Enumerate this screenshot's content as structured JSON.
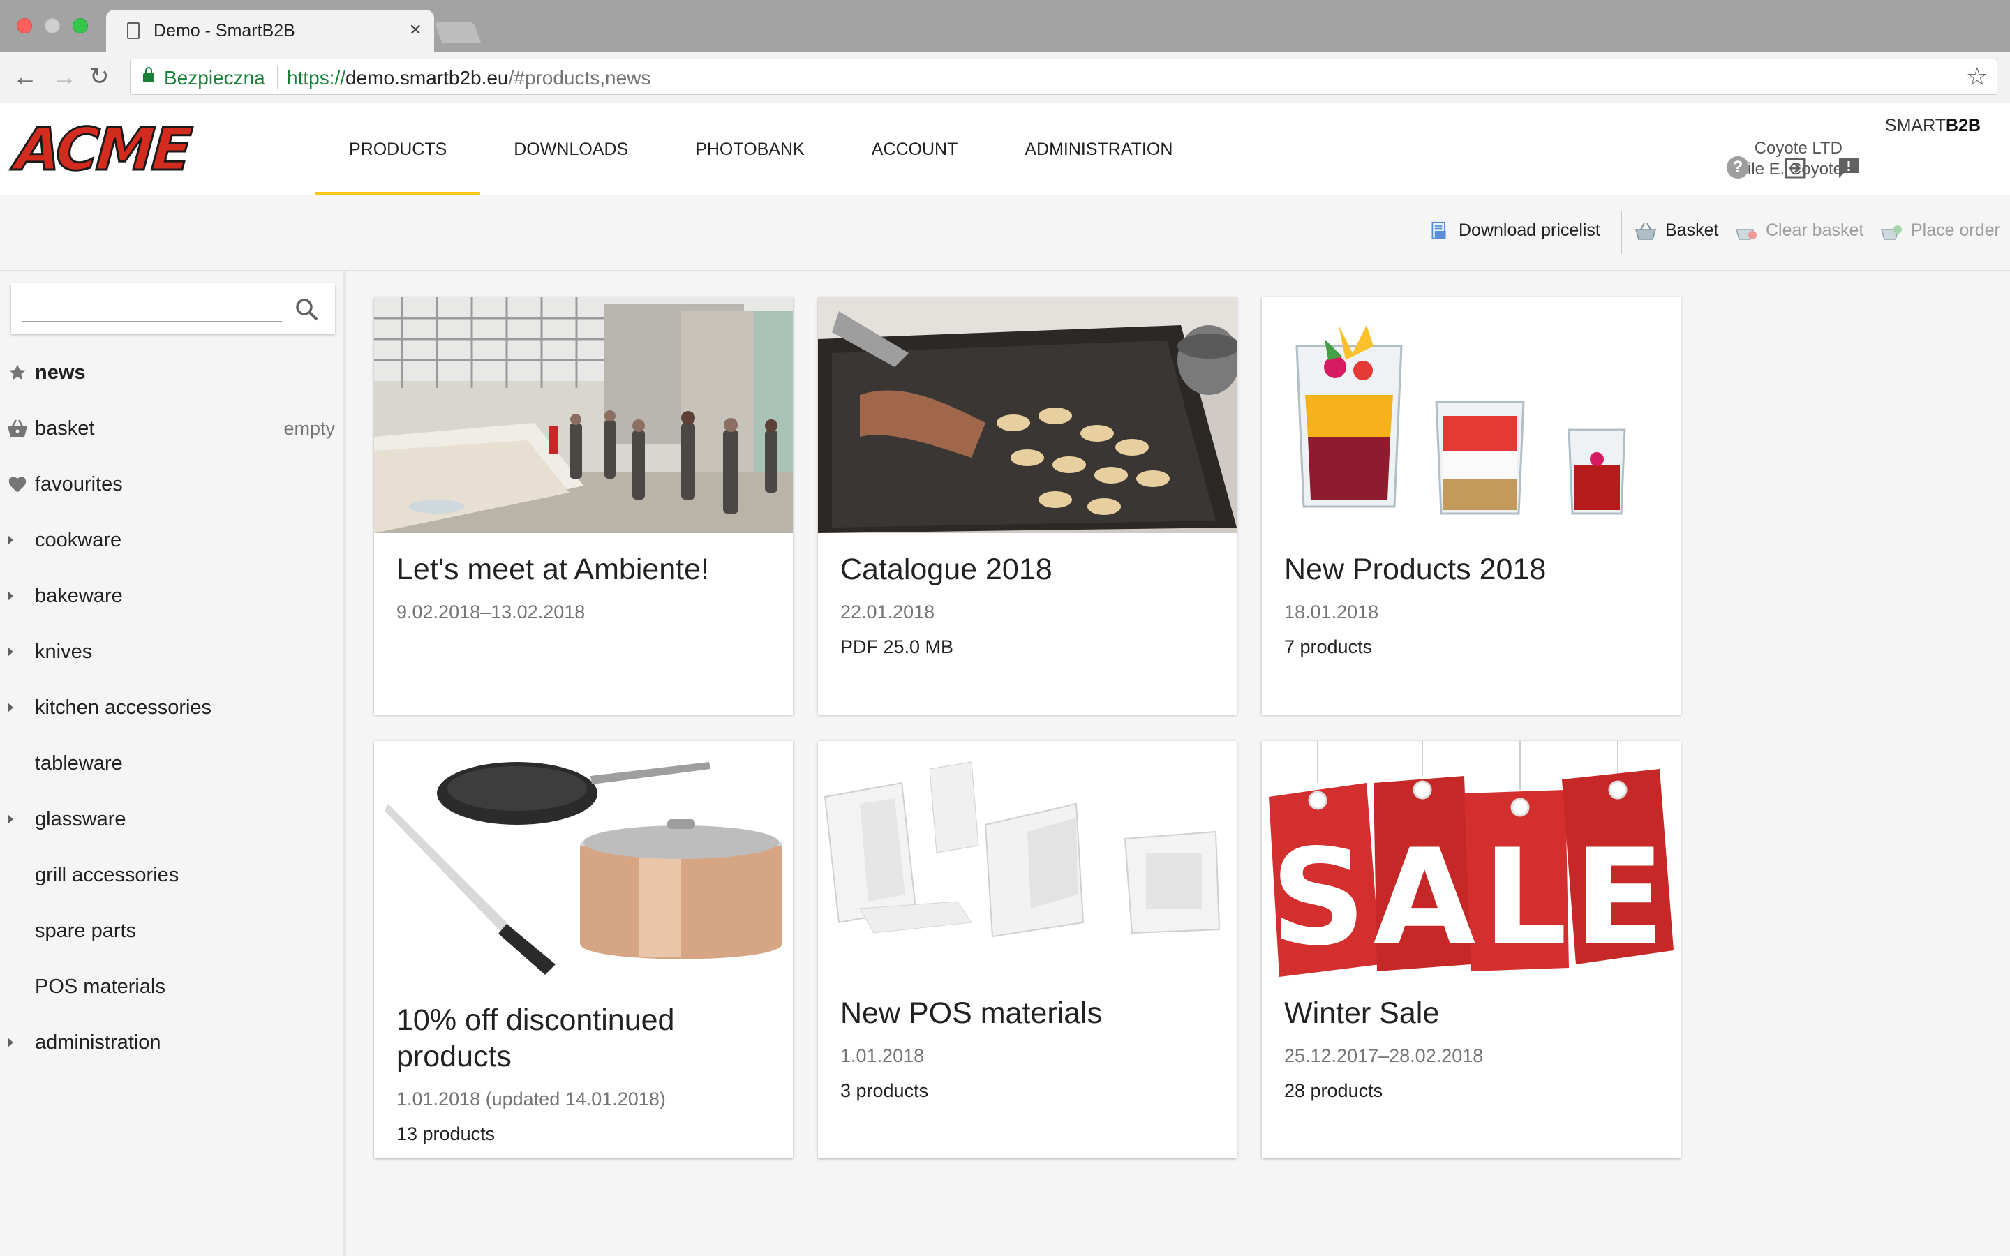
{
  "browser": {
    "tab_title": "Demo - SmartB2B",
    "secure_label": "Bezpieczna",
    "url_scheme": "https://",
    "url_host": "demo.smartb2b.eu",
    "url_rest": "/#products,news"
  },
  "header": {
    "logo_text": "ACME",
    "nav": [
      "PRODUCTS",
      "DOWNLOADS",
      "PHOTOBANK",
      "ACCOUNT",
      "ADMINISTRATION"
    ],
    "active_nav": "PRODUCTS",
    "brand_light": "SMART",
    "brand_bold": "B2B",
    "company": "Coyote LTD",
    "user": "Wile E. Coyote",
    "accent_color": "#f5c518"
  },
  "toolbar": {
    "download_pricelist": "Download pricelist",
    "basket": "Basket",
    "clear_basket": "Clear basket",
    "place_order": "Place order"
  },
  "sidebar": {
    "search_value": "",
    "items": [
      {
        "label": "news",
        "icon": "star-icon",
        "extra": ""
      },
      {
        "label": "basket",
        "icon": "basket-icon",
        "extra": "empty"
      },
      {
        "label": "favourites",
        "icon": "heart-icon",
        "extra": ""
      },
      {
        "label": "cookware",
        "icon": "caret-right-icon",
        "extra": ""
      },
      {
        "label": "bakeware",
        "icon": "caret-right-icon",
        "extra": ""
      },
      {
        "label": "knives",
        "icon": "caret-right-icon",
        "extra": ""
      },
      {
        "label": "kitchen accessories",
        "icon": "caret-right-icon",
        "extra": ""
      },
      {
        "label": "tableware",
        "icon": "",
        "extra": ""
      },
      {
        "label": "glassware",
        "icon": "caret-right-icon",
        "extra": ""
      },
      {
        "label": "grill accessories",
        "icon": "",
        "extra": ""
      },
      {
        "label": "spare parts",
        "icon": "",
        "extra": ""
      },
      {
        "label": "POS materials",
        "icon": "",
        "extra": ""
      },
      {
        "label": "administration",
        "icon": "caret-right-icon",
        "extra": ""
      }
    ]
  },
  "cards": [
    {
      "title": "Let's meet at Ambiente!",
      "date": "9.02.2018–13.02.2018",
      "info": ""
    },
    {
      "title": "Catalogue 2018",
      "date": "22.01.2018",
      "info": "PDF 25.0 MB"
    },
    {
      "title": "New Products 2018",
      "date": "18.01.2018",
      "info": "7 products"
    },
    {
      "title": "10% off discontinued products",
      "date": "1.01.2018 (updated 14.01.2018)",
      "info": "13 products"
    },
    {
      "title": "New POS materials",
      "date": "1.01.2018",
      "info": "3 products"
    },
    {
      "title": "Winter Sale",
      "date": "25.12.2017–28.02.2018",
      "info": "28 products",
      "sale_text": "SALE"
    }
  ]
}
